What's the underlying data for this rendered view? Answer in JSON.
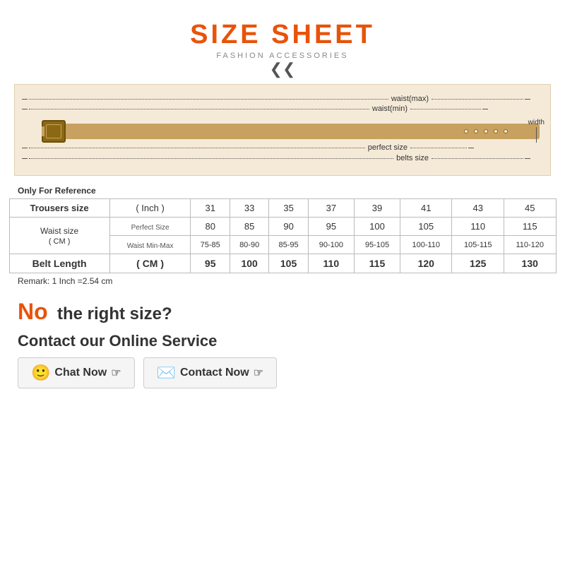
{
  "header": {
    "title": "SIZE SHEET",
    "subtitle": "FASHION ACCESSORIES"
  },
  "belt_diagram": {
    "labels": {
      "waist_max": "waist(max)",
      "waist_min": "waist(min)",
      "perfect_size": "perfect size",
      "belts_size": "belts size",
      "width": "width"
    }
  },
  "only_ref": "Only For Reference",
  "table": {
    "col_headers": [
      "31",
      "33",
      "35",
      "37",
      "39",
      "41",
      "43",
      "45"
    ],
    "row1_label": "Trousers size",
    "row1_unit": "( Inch )",
    "row2_label": "Waist size",
    "row2_unit": "( CM )",
    "row2_sub1": "Perfect Size",
    "row2_sub2": "Waist Min-Max",
    "row3_label": "Belt Length",
    "row3_unit": "( CM )",
    "perfect_sizes": [
      "80",
      "85",
      "90",
      "95",
      "100",
      "105",
      "110",
      "115"
    ],
    "waist_minmax": [
      "75-85",
      "80-90",
      "85-95",
      "90-100",
      "95-105",
      "100-110",
      "105-115",
      "110-120"
    ],
    "belt_lengths": [
      "95",
      "100",
      "105",
      "110",
      "115",
      "120",
      "125",
      "130"
    ]
  },
  "remark": "Remark: 1 Inch =2.54 cm",
  "bottom": {
    "no_label": "No",
    "right_size_text": "the right size?",
    "contact_service": "Contact our Online Service",
    "chat_now": "Chat Now",
    "contact_now": "Contact Now"
  }
}
